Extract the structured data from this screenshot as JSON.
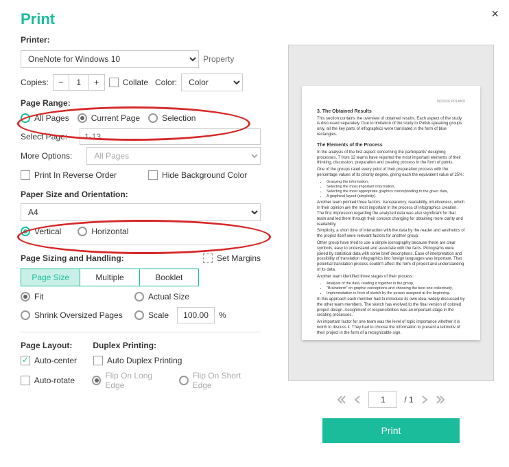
{
  "title": "Print",
  "close": "×",
  "printer": {
    "label": "Printer:",
    "selected": "OneNote for Windows 10",
    "property": "Property"
  },
  "copies": {
    "label": "Copies:",
    "value": "1",
    "minus": "−",
    "plus": "+"
  },
  "collate": "Collate",
  "color": {
    "label": "Color:",
    "selected": "Color"
  },
  "pageRange": {
    "label": "Page Range:",
    "all": "All Pages",
    "current": "Current Page",
    "selection": "Selection"
  },
  "selectPage": {
    "label": "Select Page:",
    "placeholder": "1-13"
  },
  "moreOptions": {
    "label": "More Options:",
    "selected": "All Pages"
  },
  "reverse": "Print In Reverse Order",
  "hideBg": "Hide Background Color",
  "paper": {
    "label": "Paper Size and Orientation:",
    "selected": "A4",
    "vertical": "Vertical",
    "horizontal": "Horizontal"
  },
  "sizing": {
    "label": "Page Sizing and Handling:",
    "setMargins": "Set Margins",
    "tab1": "Page Size",
    "tab2": "Multiple",
    "tab3": "Booklet",
    "fit": "Fit",
    "actual": "Actual Size",
    "shrink": "Shrink Oversized Pages",
    "scale": "Scale",
    "scaleVal": "100.00",
    "pct": "%"
  },
  "layout": {
    "label": "Page Layout:",
    "autocenter": "Auto-center",
    "autorotate": "Auto-rotate"
  },
  "duplex": {
    "label": "Duplex Printing:",
    "auto": "Auto Duplex Printing",
    "long": "Flip On Long Edge",
    "short": "Flip On Short Edge"
  },
  "nav": {
    "page": "1",
    "total": "/ 1"
  },
  "printBtn": "Print",
  "doc": {
    "topright": "ISD2016 POLAND",
    "h1": "3.   The Obtained Results",
    "p1": "This section contains the overview of obtained results. Each aspect of the study is discussed separately. Due to limitation of the study to Polish-speaking groups only, all the key parts of infographics were translated in the form of blue rectangles.",
    "h2": "The Elements of the Process",
    "p2": "In the analysis of the first aspect concerning the participants' designing processes, 7 from 12 teams have reported the most important elements of their thinking, discussion, preparation and creating process in the form of points.",
    "p3": "One of the groups rated every point of their preparation process with the percentage values of its priority degree, giving each the equivalent value of 25%:",
    "b1": "Grasping the information,",
    "b2": "Selecting the most important information,",
    "b3": "Selecting the most appropriate graphics corresponding to the given data,",
    "b4": "A graphical layout (simplicity).",
    "p4": "Another team pointed three factors: transparency, readability, intuitiveness, which in their opinion are the most important in the process of infographics creation. The first impression regarding the analyzed data was also significant for that team and led them through their concept changing for obtaining more clarity and readability.",
    "p5": "Simplicity, a short time of interaction with the data by the reader and aesthetics of the project itself were relevant factors for another group.",
    "p6": "Other group have tried to use a simple iconography because these are clear symbols, easy to understand and associate with the facts. Pictograms were joined by statistical data with some brief descriptions. Ease of interpretation and possibility of translation infographics into foreign languages was important. That potential translation process couldn't affect the form of project and understanding of its data.",
    "p7": "Another team identified three stages of their process:",
    "c1": "Analysis of the data, reading it together in the group,",
    "c2": "\"Brainstorm\" on graphic conceptions and choosing the best one collectively,",
    "c3": "Implementation in form of sketch by the person assigned at the beginning.",
    "p8": "In this approach each member had to introduce its own idea, widely discussed by the other team members. The sketch has evolved to the final version of colored project design. Assignment of responsibilities was an important stage in the creating processes.",
    "p9": "An important factor for one team was the level of topic importance whether it is worth to discuss it. They had to choose the information to present a leitmotiv of their project in the form of a recognizable sign."
  }
}
